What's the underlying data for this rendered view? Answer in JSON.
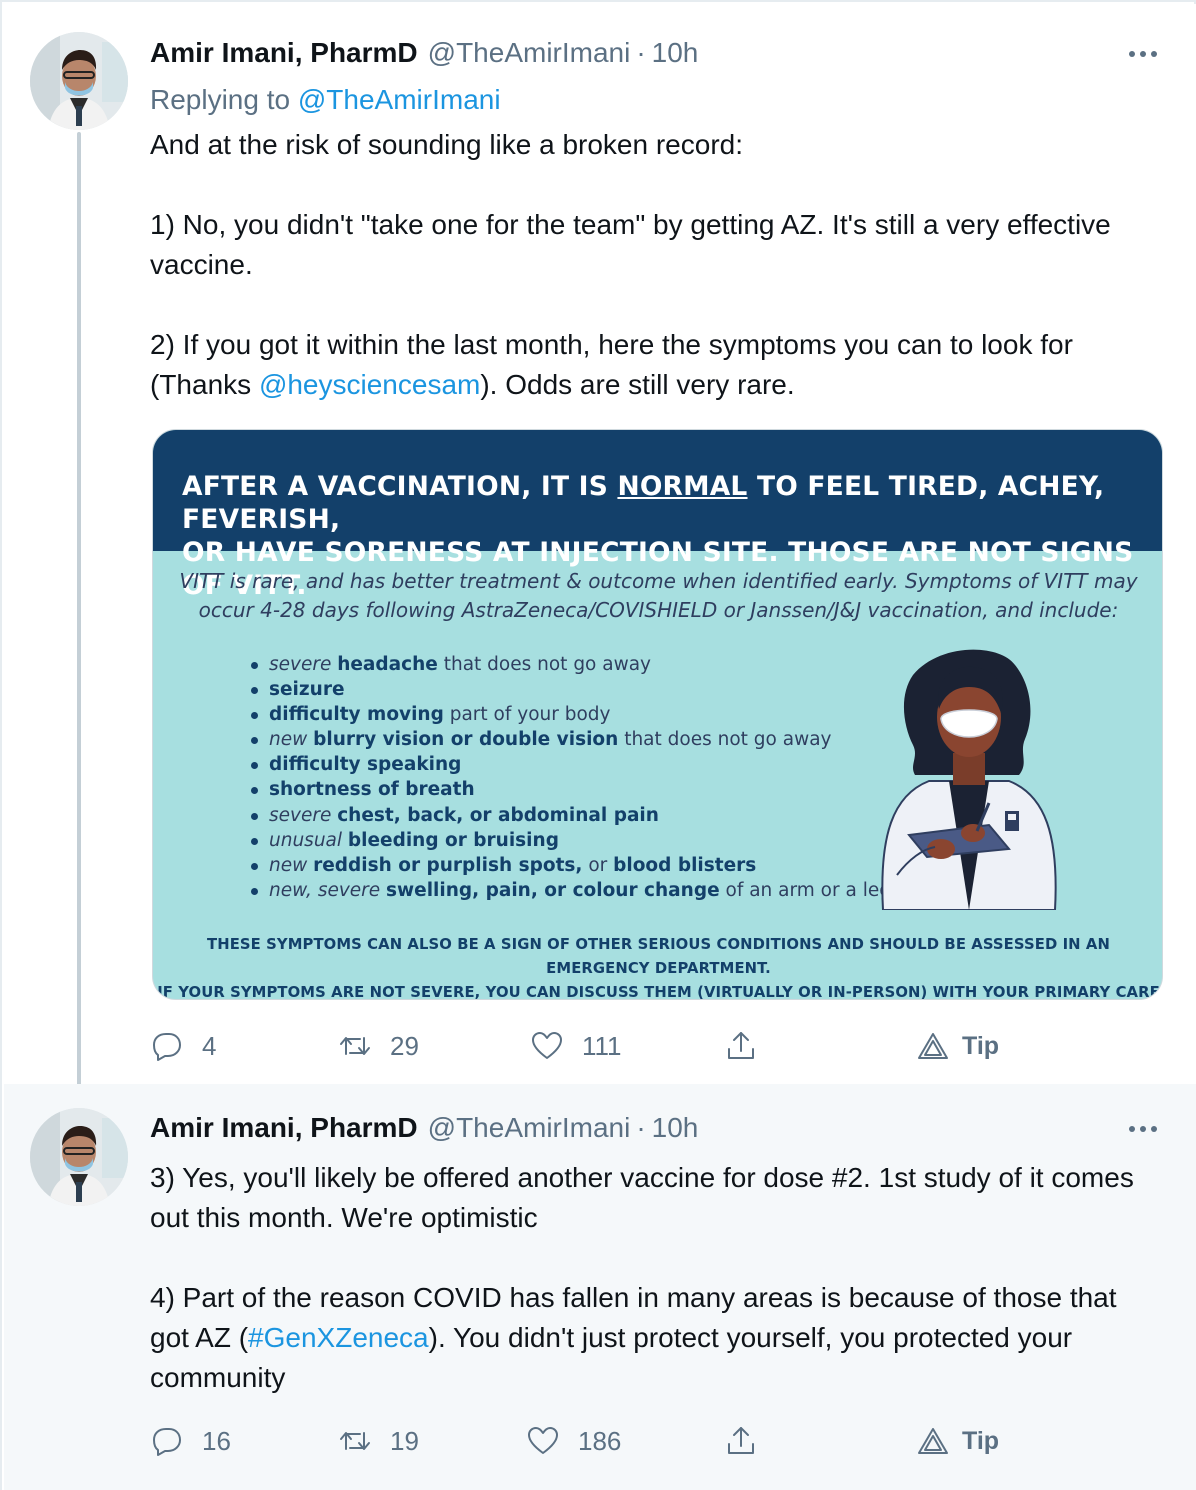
{
  "tweet1": {
    "name": "Amir Imani, PharmD",
    "handle": "@TheAmirImani",
    "separator": "·",
    "time": "10h",
    "replying_prefix": "Replying to ",
    "replying_to": "@TheAmirImani",
    "lines": {
      "l1": "And at the risk of sounding like a broken record:",
      "l2": "1) No, you didn't \"take one for the team\" by getting AZ. It's still a very effective vaccine.",
      "l3a": "2) If you got it within the last month, here the symptoms you can to look for (Thanks ",
      "l3_mention": "@heysciencesam",
      "l3b": "). Odds are still very rare."
    },
    "image": {
      "banner_1": "AFTER A VACCINATION, IT IS ",
      "banner_normal": "NORMAL",
      "banner_2": " TO FEEL TIRED, ACHEY, FEVERISH,",
      "banner_3": "OR HAVE SORENESS AT INJECTION SITE. THOSE ARE NOT SIGNS OF VITT.",
      "intro_1": "VITT is rare, and has better treatment & outcome when identified early. Symptoms of VITT may",
      "intro_2": "occur 4-28 days following AstraZeneca/COVISHIELD or Janssen/J&J vaccination, and include:",
      "symptoms": {
        "s1a": "severe ",
        "s1b": "headache",
        "s1c": " that does not go away",
        "s2b": "seizure",
        "s3b": "difficulty moving",
        "s3c": " part of your body",
        "s4a": "new ",
        "s4b": "blurry vision or double vision",
        "s4c": " that does not go away",
        "s5b": "difficulty speaking",
        "s6b": "shortness of breath",
        "s7a": "severe ",
        "s7b": "chest, back, or abdominal pain",
        "s8a": "unusual ",
        "s8b": "bleeding or bruising",
        "s9a": "new ",
        "s9b": "reddish or purplish spots,",
        "s9c": " or ",
        "s9d": "blood blisters",
        "s10a": "new, severe ",
        "s10b": "swelling, pain, or colour change",
        "s10c": " of an arm or a leg"
      },
      "footer_1": "THESE SYMPTOMS CAN ALSO BE A SIGN OF OTHER SERIOUS CONDITIONS AND SHOULD BE ASSESSED IN AN EMERGENCY DEPARTMENT.",
      "footer_2": "IF YOUR SYMPTOMS ARE NOT SEVERE, YOU CAN DISCUSS THEM (VIRTUALLY OR IN-PERSON) WITH YOUR PRIMARY CARE PROFESSIONAL."
    },
    "actions": {
      "replies": "4",
      "retweets": "29",
      "likes": "111",
      "tip": "Tip"
    }
  },
  "tweet2": {
    "name": "Amir Imani, PharmD",
    "handle": "@TheAmirImani",
    "separator": "·",
    "time": "10h",
    "lines": {
      "l1": "3) Yes, you'll likely be offered another vaccine for dose #2. 1st study of it comes out this month. We're optimistic",
      "l2a": "4) Part of the reason COVID has fallen in many areas is because of those that got AZ (",
      "l2_hashtag": "#GenXZeneca",
      "l2b": "). You didn't just protect yourself, you protected your community"
    },
    "actions": {
      "replies": "16",
      "retweets": "19",
      "likes": "186",
      "tip": "Tip"
    }
  },
  "icons": {
    "reply": "reply-icon",
    "retweet": "retweet-icon",
    "like": "heart-icon",
    "share": "share-icon",
    "tip": "tip-icon",
    "more": "more-icon"
  },
  "colors": {
    "link": "#1b95e0",
    "secondary_text": "#5b7083",
    "infographic_banner": "#13406a",
    "infographic_bg": "#a7dfe0",
    "thread_line": "#c4cfd6"
  }
}
